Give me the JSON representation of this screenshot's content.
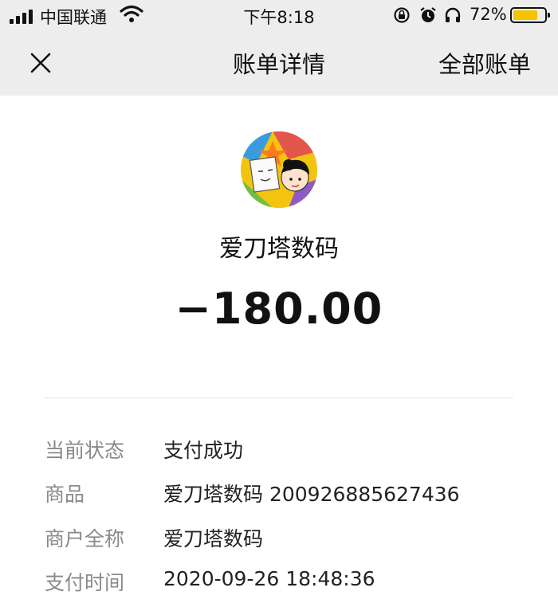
{
  "status_bar": {
    "carrier": "中国联通",
    "time": "下午8:18",
    "battery_percent": "72%",
    "battery_level": 0.72,
    "icons": [
      "signal-icon",
      "wifi-icon",
      "orientation-lock-icon",
      "alarm-icon",
      "headphones-icon",
      "battery-icon"
    ]
  },
  "nav": {
    "title": "账单详情",
    "right_action": "全部账单",
    "close_icon": "close-icon"
  },
  "merchant": {
    "name": "爱刀塔数码",
    "amount": "−180.00"
  },
  "details": [
    {
      "label": "当前状态",
      "value": "支付成功"
    },
    {
      "label": "商品",
      "value": "爱刀塔数码 200926885627436"
    },
    {
      "label": "商户全称",
      "value": "爱刀塔数码"
    },
    {
      "label": "支付时间",
      "value": "2020-09-26 18:48:36"
    }
  ],
  "colors": {
    "header_bg": "#ededed",
    "battery": "#f5c300",
    "label_gray": "#8a8a8a"
  }
}
